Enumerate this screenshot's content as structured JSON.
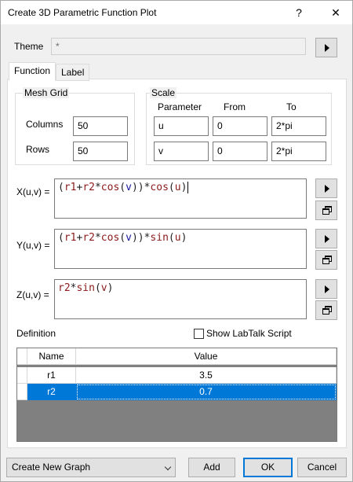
{
  "window": {
    "title": "Create 3D Parametric Function Plot",
    "help_label": "?",
    "close_label": "✕"
  },
  "theme": {
    "label": "Theme",
    "value": "*"
  },
  "tabs": [
    {
      "label": "Function",
      "active": true
    },
    {
      "label": "Label",
      "active": false
    }
  ],
  "mesh_grid": {
    "title": "Mesh Grid",
    "columns_label": "Columns",
    "columns_value": "50",
    "rows_label": "Rows",
    "rows_value": "50"
  },
  "scale": {
    "title": "Scale",
    "headers": [
      "Parameter",
      "From",
      "To"
    ],
    "rows": [
      {
        "param": "u",
        "from": "0",
        "to": "2*pi"
      },
      {
        "param": "v",
        "from": "0",
        "to": "2*pi"
      }
    ]
  },
  "functions": {
    "x": {
      "label": "X(u,v) =",
      "tokens": [
        {
          "t": "(",
          "c": "#222"
        },
        {
          "t": "r1",
          "c": "#8b1a1a"
        },
        {
          "t": "+",
          "c": "#222"
        },
        {
          "t": "r2",
          "c": "#8b1a1a"
        },
        {
          "t": "*",
          "c": "#222"
        },
        {
          "t": "cos",
          "c": "#8b1a1a"
        },
        {
          "t": "(",
          "c": "#222"
        },
        {
          "t": "v",
          "c": "#1a1a9b"
        },
        {
          "t": "))",
          "c": "#222"
        },
        {
          "t": "*",
          "c": "#222"
        },
        {
          "t": "cos",
          "c": "#8b1a1a"
        },
        {
          "t": "(",
          "c": "#222"
        },
        {
          "t": "u",
          "c": "#8b1a1a"
        },
        {
          "t": ")",
          "c": "#222"
        }
      ]
    },
    "y": {
      "label": "Y(u,v) =",
      "tokens": [
        {
          "t": "(",
          "c": "#222"
        },
        {
          "t": "r1",
          "c": "#8b1a1a"
        },
        {
          "t": "+",
          "c": "#222"
        },
        {
          "t": "r2",
          "c": "#8b1a1a"
        },
        {
          "t": "*",
          "c": "#222"
        },
        {
          "t": "cos",
          "c": "#8b1a1a"
        },
        {
          "t": "(",
          "c": "#222"
        },
        {
          "t": "v",
          "c": "#1a1a9b"
        },
        {
          "t": "))",
          "c": "#222"
        },
        {
          "t": "*",
          "c": "#222"
        },
        {
          "t": "sin",
          "c": "#8b1a1a"
        },
        {
          "t": "(",
          "c": "#222"
        },
        {
          "t": "u",
          "c": "#8b1a1a"
        },
        {
          "t": ")",
          "c": "#222"
        }
      ]
    },
    "z": {
      "label": "Z(u,v) =",
      "tokens": [
        {
          "t": "r2",
          "c": "#8b1a1a"
        },
        {
          "t": "*",
          "c": "#222"
        },
        {
          "t": "sin",
          "c": "#8b1a1a"
        },
        {
          "t": "(",
          "c": "#222"
        },
        {
          "t": "v",
          "c": "#8b1a1a"
        },
        {
          "t": ")",
          "c": "#222"
        }
      ]
    }
  },
  "definition": {
    "label": "Definition",
    "show_script_label": "Show LabTalk Script",
    "show_script_checked": false,
    "columns": [
      "Name",
      "Value"
    ],
    "rows": [
      {
        "name": "r1",
        "value": "3.5",
        "selected": false
      },
      {
        "name": "r2",
        "value": "0.7",
        "selected": true
      }
    ]
  },
  "footer": {
    "dropdown_value": "Create New Graph",
    "add_label": "Add",
    "ok_label": "OK",
    "cancel_label": "Cancel"
  },
  "colors": {
    "accent": "#0078d7",
    "selection": "#0078d7"
  }
}
